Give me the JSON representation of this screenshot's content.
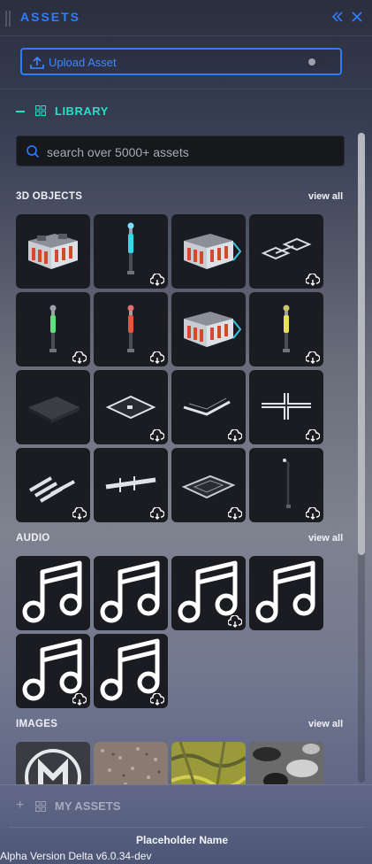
{
  "header": {
    "title": "ASSETS",
    "collapse_icon": "double-chevron-left-icon",
    "close_icon": "close-icon"
  },
  "upload": {
    "label": "Upload Asset",
    "icon": "upload-icon",
    "toggle_on": false
  },
  "library": {
    "label": "LIBRARY",
    "expanded": true,
    "icon": "grid-icon"
  },
  "search": {
    "placeholder": "search over 5000+ assets",
    "value": "",
    "icon": "search-icon"
  },
  "sections": {
    "objects": {
      "title": "3D OBJECTS",
      "view_all": "view all",
      "tiles": [
        "generator-crate",
        "beacon-cyan",
        "generator-crate",
        "road-pieces",
        "beacon-green",
        "beacon-red",
        "generator-crate",
        "beacon-yellow",
        "ground-tile",
        "road-square",
        "road-corner",
        "road-cross",
        "crosswalk",
        "road-segment",
        "road-plaza",
        "street-lamp"
      ]
    },
    "audio": {
      "title": "AUDIO",
      "view_all": "view all",
      "count": 6,
      "icon": "music-note-icon"
    },
    "images": {
      "title": "IMAGES",
      "view_all": "view all",
      "tiles": [
        "logo",
        "gravel-texture",
        "moss-texture",
        "noise-texture"
      ]
    }
  },
  "my_assets": {
    "label": "MY ASSETS",
    "expanded": false
  },
  "footer": {
    "name": "Placeholder Name",
    "version": "Alpha Version Delta v6.0.34-dev"
  },
  "colors": {
    "accent": "#2f7dff",
    "teal": "#22e0c6",
    "tile_bg": "#1b1c21"
  }
}
